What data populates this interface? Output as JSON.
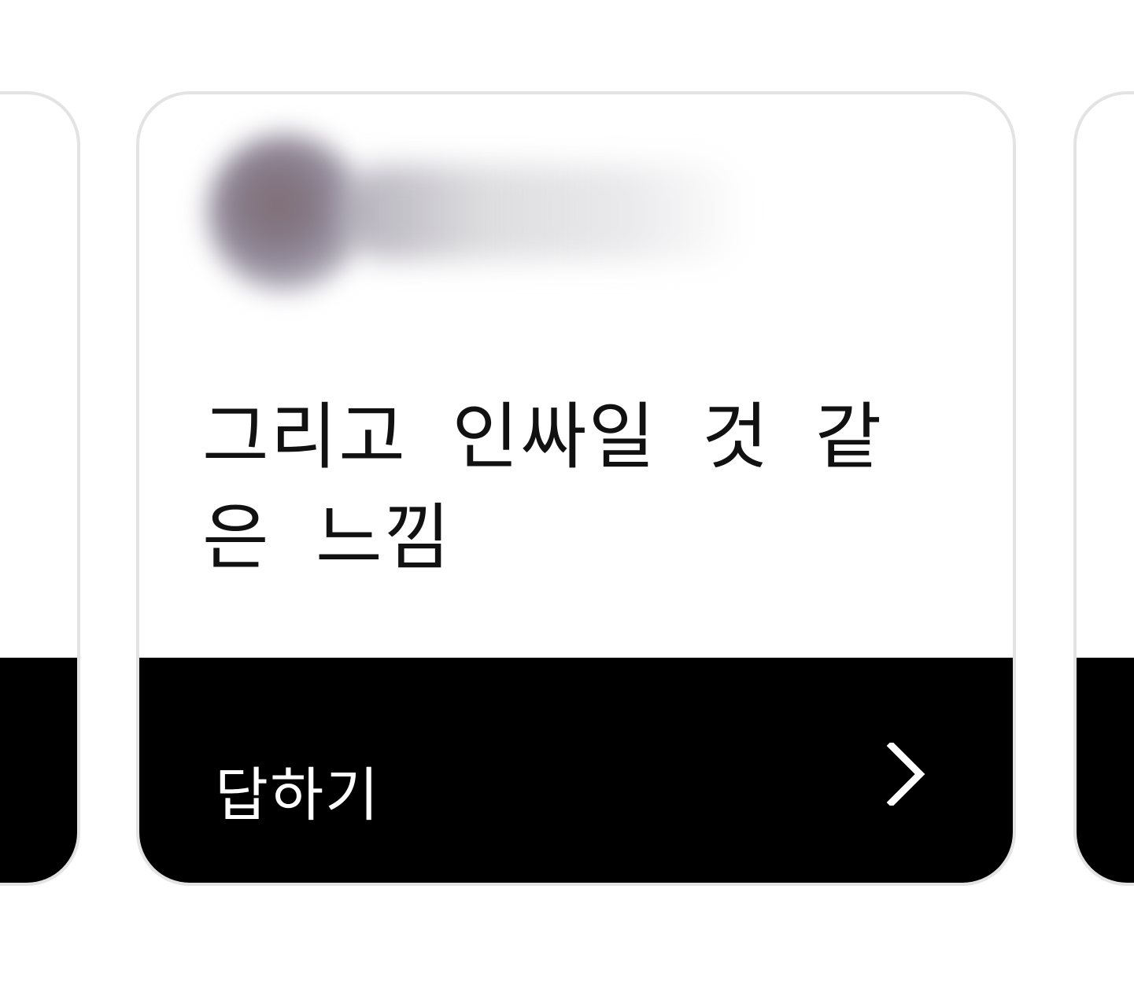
{
  "card": {
    "author_name": "",
    "question": "그리고 인싸일 것 같은 느낌",
    "answer_label": "답하기",
    "answer_icon": "chevron-right-icon"
  },
  "colors": {
    "background": "#ffffff",
    "card_border": "#e3e3e3",
    "footer": "#000000",
    "question_text": "#111111",
    "footer_text": "#ffffff"
  }
}
